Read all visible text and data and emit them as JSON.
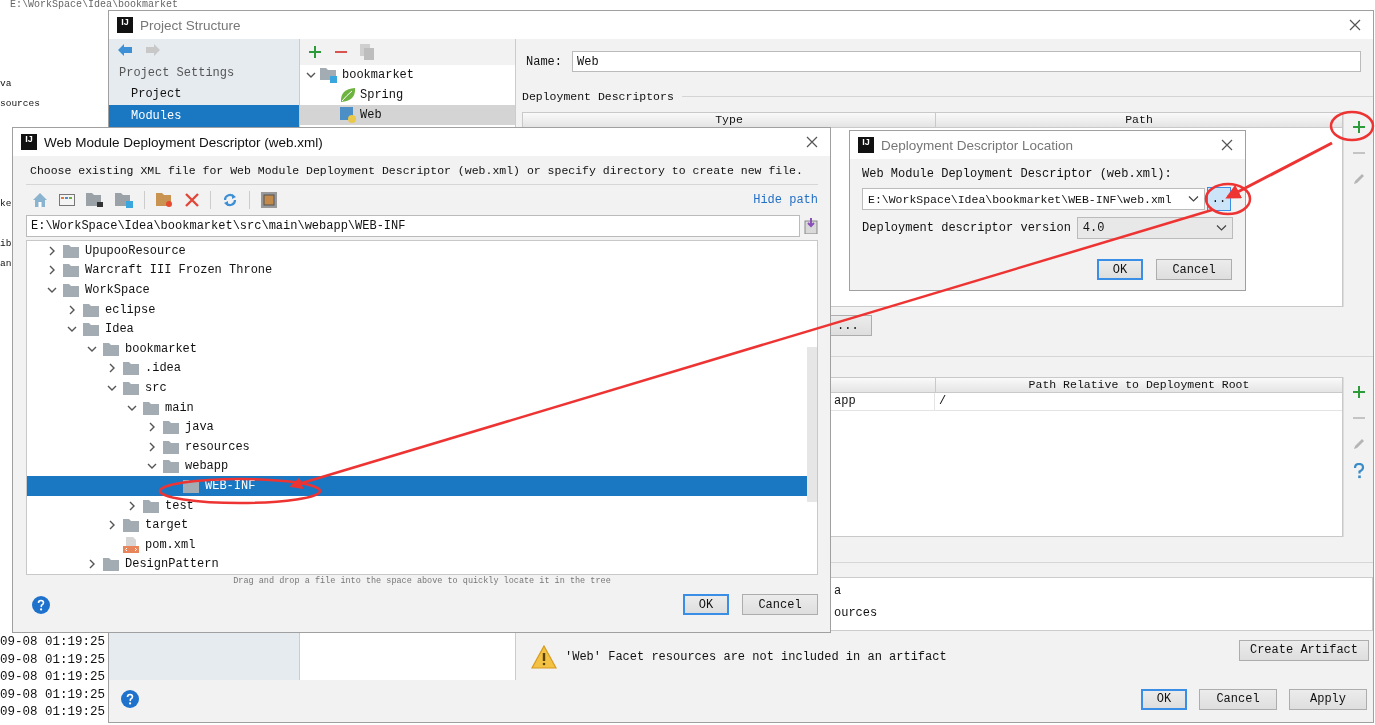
{
  "background_ide": {
    "path_text": "E:\\WorkSpace\\Idea\\bookmarket",
    "tree_fragments": [
      "va",
      "sources",
      "ke",
      "ib",
      "an"
    ],
    "log_lines": [
      "09-08 01:19:25",
      "09-08 01:19:25",
      "09-08 01:19:25",
      "09-08 01:19:25",
      "09-08 01:19:25"
    ]
  },
  "project_structure": {
    "logo": "IJ",
    "title": "Project Structure",
    "sidebar": {
      "heading": "Project Settings",
      "items": [
        {
          "label": "Project",
          "selected": false
        },
        {
          "label": "Modules",
          "selected": true
        }
      ]
    },
    "module_tree": [
      {
        "label": "bookmarket",
        "kind": "module",
        "expanded": true,
        "selected": false,
        "children": [
          {
            "label": "Spring",
            "kind": "spring",
            "selected": false
          },
          {
            "label": "Web",
            "kind": "web",
            "selected": true
          }
        ]
      }
    ],
    "name_label": "Name:",
    "name_value": "Web",
    "descriptors_heading": "Deployment Descriptors",
    "descriptor_columns": [
      "Type",
      "Path"
    ],
    "browse_button": "...",
    "resource_column_2": "Path Relative to Deployment Root",
    "resource_rows": [
      {
        "column_1": "app",
        "column_2": "/"
      }
    ],
    "source_roots": [
      "a",
      "ources"
    ],
    "warning": "'Web' Facet resources are not included in an artifact",
    "create_artifact": "Create Artifact",
    "buttons": [
      {
        "label": "OK",
        "default": true
      },
      {
        "label": "Cancel",
        "default": false
      },
      {
        "label": "Apply",
        "default": false
      }
    ]
  },
  "web_xml_dialog": {
    "logo": "IJ",
    "title": "Web Module Deployment Descriptor (web.xml)",
    "description": "Choose existing XML file for Web Module Deployment Descriptor (web.xml) or specify directory to create new file.",
    "hide_path": "Hide path",
    "path_value": "E:\\WorkSpace\\Idea\\bookmarket\\src\\main\\webapp\\WEB-INF",
    "tree": [
      {
        "label": "UpupooResource",
        "kind": "folder",
        "expanded": false,
        "selected": false
      },
      {
        "label": "Warcraft III Frozen Throne",
        "kind": "folder",
        "expanded": false,
        "selected": false
      },
      {
        "label": "WorkSpace",
        "kind": "folder",
        "expanded": true,
        "selected": false,
        "children": [
          {
            "label": "eclipse",
            "kind": "folder",
            "expanded": false,
            "selected": false
          },
          {
            "label": "Idea",
            "kind": "folder",
            "expanded": true,
            "selected": false,
            "children": [
              {
                "label": "bookmarket",
                "kind": "folder",
                "expanded": true,
                "selected": false,
                "children": [
                  {
                    "label": ".idea",
                    "kind": "folder",
                    "expanded": false,
                    "selected": false
                  },
                  {
                    "label": "src",
                    "kind": "folder",
                    "expanded": true,
                    "selected": false,
                    "children": [
                      {
                        "label": "main",
                        "kind": "folder",
                        "expanded": true,
                        "selected": false,
                        "children": [
                          {
                            "label": "java",
                            "kind": "folder",
                            "expanded": false,
                            "selected": false
                          },
                          {
                            "label": "resources",
                            "kind": "folder",
                            "expanded": false,
                            "selected": false
                          },
                          {
                            "label": "webapp",
                            "kind": "folder",
                            "expanded": true,
                            "selected": false,
                            "children": [
                              {
                                "label": "WEB-INF",
                                "kind": "folder",
                                "selected": true
                              }
                            ]
                          }
                        ]
                      },
                      {
                        "label": "test",
                        "kind": "folder",
                        "expanded": false,
                        "selected": false
                      }
                    ]
                  },
                  {
                    "label": "target",
                    "kind": "folder",
                    "expanded": false,
                    "selected": false
                  },
                  {
                    "label": "pom.xml",
                    "kind": "file",
                    "selected": false
                  }
                ]
              },
              {
                "label": "DesignPattern",
                "kind": "folder",
                "expanded": false,
                "selected": false
              }
            ]
          }
        ]
      }
    ],
    "hint": "Drag and drop a file into the space above to quickly locate it in the tree",
    "buttons": [
      {
        "label": "OK",
        "default": true
      },
      {
        "label": "Cancel",
        "default": false
      }
    ]
  },
  "location_dialog": {
    "logo": "IJ",
    "title": "Deployment Descriptor Location",
    "descriptor_label": "Web Module Deployment Descriptor (web.xml):",
    "descriptor_path": "E:\\WorkSpace\\Idea\\bookmarket\\WEB-INF\\web.xml",
    "browse_button": "..",
    "version_label": "Deployment descriptor version",
    "version_value": "4.0",
    "buttons": [
      {
        "label": "OK",
        "default": true
      },
      {
        "label": "Cancel",
        "default": false
      }
    ]
  }
}
